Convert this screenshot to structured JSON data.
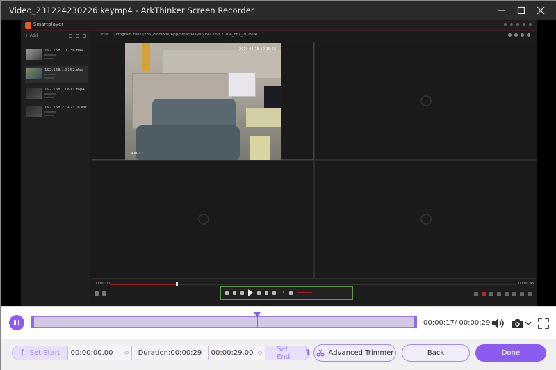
{
  "window": {
    "title": "Video_231224230226.keymp4  -  ArkThinker Screen Recorder",
    "controls": [
      "minimize",
      "maximize",
      "close"
    ]
  },
  "recorded_content": {
    "app_name": "Smartplayer",
    "sidebar": {
      "add_label": "+ Add",
      "files": [
        {
          "name": "192.168....1736.dav",
          "selected": false
        },
        {
          "name": "192.168....3152.dav",
          "selected": true
        },
        {
          "name": "192.168....0611.mp4",
          "selected": false
        },
        {
          "name": "192.168.2...42116.asf",
          "selected": false
        }
      ]
    },
    "file_path": "File: C:/Program Files (x86)/SoolBox/App/SmartPlayer/192.168.2.204_ch1_201904...",
    "camera_label": "CAM 17",
    "camera_timestamp": "2019-04-18 10:15:22",
    "start_time": "00:00:00",
    "end_time": "00:00:45",
    "progress_fraction": 0.17,
    "speed": "1X"
  },
  "timeline": {
    "current_time": "00:00:17",
    "total_time": "00:00:29",
    "readout": "00:00:17/ 00:00:29",
    "playhead_fraction": 0.586,
    "play_state": "playing"
  },
  "trim": {
    "set_start_label": "Set Start",
    "start_value": "00:00:00.00",
    "duration_label": "Duration:00:00:29",
    "end_value": "00:00:29.00",
    "set_end_label": "Set End"
  },
  "buttons": {
    "advanced_trimmer": "Advanced Trimmer",
    "back": "Back",
    "done": "Done"
  },
  "colors": {
    "accent": "#8c5cf0",
    "track": "#d3c9e3",
    "titlebar": "#2b2b2b"
  }
}
